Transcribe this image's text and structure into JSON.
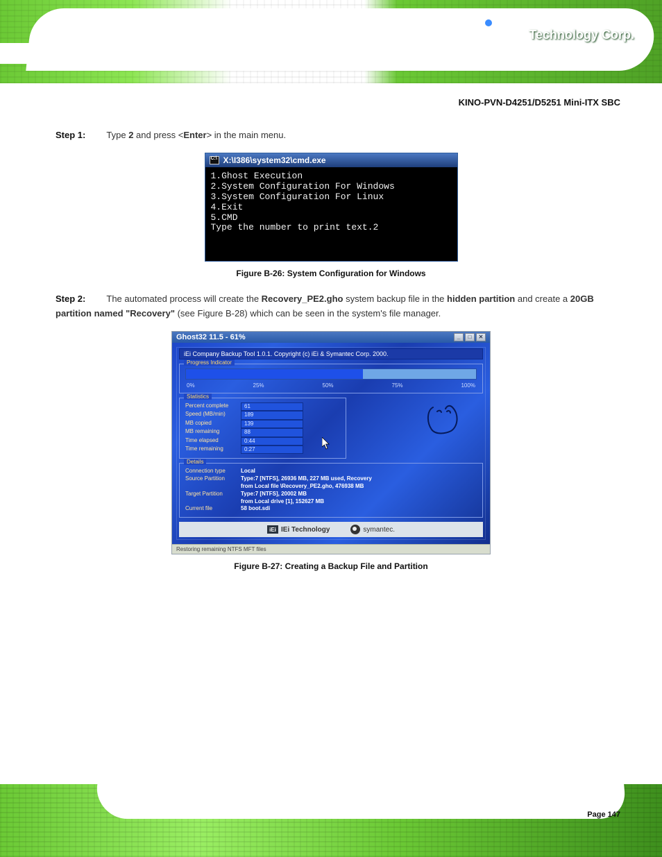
{
  "header": {
    "company": "Technology Corp."
  },
  "product_line": "KINO-PVN-D4251/D5251 Mini-ITX SBC",
  "step1": {
    "number": "Step 1:",
    "text_before": "Type ",
    "cmd": "2",
    "text_after": " and press <",
    "keycap": "Enter",
    "text_end": "> in the main menu."
  },
  "cmd_window": {
    "title": "X:\\I386\\system32\\cmd.exe",
    "lines": [
      "1.Ghost Execution",
      "2.System Configuration For Windows",
      "3.System Configuration For Linux",
      "4.Exit",
      "5.CMD",
      "Type the number to print text.2"
    ]
  },
  "fig1_caption": "Figure B-26: System Configuration for Windows",
  "step2": {
    "number": "Step 2:",
    "part1": "The automated process will create the ",
    "b1": "Recovery_PE2.gho",
    "part2": " system backup file in the ",
    "b2": "hidden partition",
    "part3": " and create a ",
    "b3": "20GB partition named \"Recovery\"",
    "part4": " (see Figure B-28) which can be seen in the system's file manager."
  },
  "ghost": {
    "title": "Ghost32 11.5 - 61%",
    "banner": "iEi Company Backup Tool 1.0.1.  Copyright (c) iEi & Symantec Corp. 2000.",
    "panel_progress": "Progress Indicator",
    "ticks": [
      "0%",
      "25%",
      "50%",
      "75%",
      "100%"
    ],
    "panel_stats": "Statistics",
    "stats": [
      {
        "label": "Percent complete",
        "value": "61"
      },
      {
        "label": "Speed (MB/min)",
        "value": "189"
      },
      {
        "label": "MB copied",
        "value": "139"
      },
      {
        "label": "MB remaining",
        "value": "88"
      },
      {
        "label": "Time elapsed",
        "value": "0:44"
      },
      {
        "label": "Time remaining",
        "value": "0:27"
      }
    ],
    "panel_details": "Details",
    "details": [
      {
        "label": "Connection type",
        "value": "Local"
      },
      {
        "label": "Source Partition",
        "value": "Type:7 [NTFS], 26936 MB, 227 MB used, Recovery"
      },
      {
        "label": "",
        "value": "from Local file \\Recovery_PE2.gho, 476938 MB"
      },
      {
        "label": "Target Partition",
        "value": "Type:7 [NTFS], 20002 MB"
      },
      {
        "label": "",
        "value": "from Local drive [1], 152627 MB"
      },
      {
        "label": "Current file",
        "value": "58 boot.sdi"
      }
    ],
    "footer_iei": "IEi Technology",
    "footer_sym": "symantec.",
    "statusbar": "Restoring remaining NTFS MFT files"
  },
  "fig2_caption": "Figure B-27: Creating a Backup File and Partition",
  "footer": {
    "page_label": "Page 147"
  },
  "chart_data": {
    "type": "bar",
    "title": "Ghost32 restore progress",
    "categories": [
      "Percent complete",
      "Speed (MB/min)",
      "MB copied",
      "MB remaining",
      "Time elapsed (s)",
      "Time remaining (s)"
    ],
    "values": [
      61,
      189,
      139,
      88,
      44,
      27
    ]
  }
}
